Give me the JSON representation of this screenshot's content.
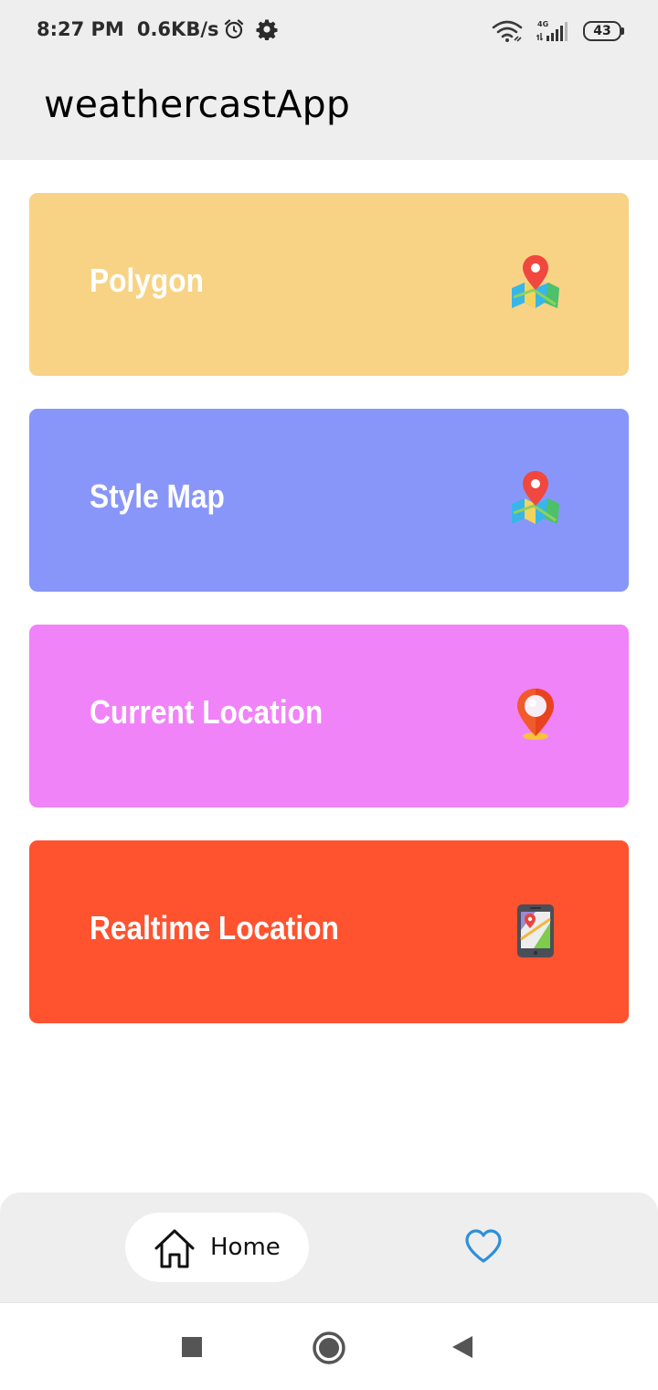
{
  "status_bar": {
    "time": "8:27 PM",
    "net_speed": "0.6KB/s",
    "alarm_icon": "alarm-clock-icon",
    "settings_icon": "gear-icon",
    "wifi_icon": "wifi-icon",
    "network_type": "4G",
    "signal_icon": "cellular-signal-icon",
    "battery_level": "43"
  },
  "app_bar": {
    "title": "weathercastApp"
  },
  "menu": {
    "items": [
      {
        "label": "Polygon",
        "icon": "map-pin-icon",
        "color": "#F8D385"
      },
      {
        "label": "Style Map",
        "icon": "map-pin-icon",
        "color": "#8896FA"
      },
      {
        "label": "Current Location",
        "icon": "location-pin-icon",
        "color": "#F083F8"
      },
      {
        "label": "Realtime Location",
        "icon": "phone-map-icon",
        "color": "#FF5330"
      }
    ]
  },
  "bottom_nav": {
    "home_label": "Home",
    "home_icon": "home-icon",
    "favorites_icon": "heart-icon",
    "accent_color": "#2F8FD8"
  },
  "system_nav": {
    "recents_icon": "square-icon",
    "home_icon": "circle-icon",
    "back_icon": "triangle-back-icon"
  }
}
